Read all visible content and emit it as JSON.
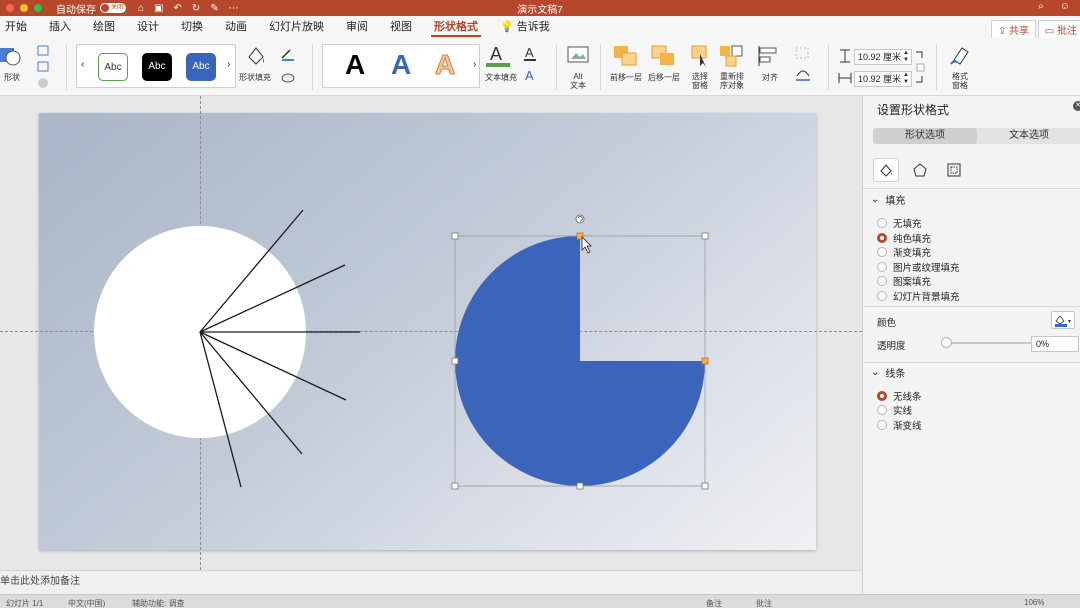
{
  "titlebar": {
    "autosave_label": "自动保存",
    "toggle_label": "关闭",
    "doc_title": "演示文稿7"
  },
  "tabs": [
    {
      "label": "开始"
    },
    {
      "label": "插入"
    },
    {
      "label": "绘图"
    },
    {
      "label": "设计"
    },
    {
      "label": "切换"
    },
    {
      "label": "动画"
    },
    {
      "label": "幻灯片放映"
    },
    {
      "label": "审阅"
    },
    {
      "label": "视图"
    },
    {
      "label": "形状格式",
      "active": true
    },
    {
      "label": "告诉我"
    }
  ],
  "header_buttons": {
    "share": "共享",
    "comment": "批注"
  },
  "ribbon": {
    "shape_label": "形状",
    "styles": [
      "Abc",
      "Abc",
      "Abc"
    ],
    "shape_fill_label": "形状填充",
    "wordart_letter": "A",
    "text_fill_label": "文本填充",
    "alt_text_label": "Alt\n文本",
    "alt_line1": "Alt",
    "alt_line2": "文本",
    "bring_forward": "前移一层",
    "send_backward": "后移一层",
    "selection_pane_1": "选择",
    "selection_pane_2": "窗格",
    "reorder_1": "重新排",
    "reorder_2": "序对象",
    "align_label": "对齐",
    "height_value": "10.92 厘米",
    "width_value": "10.92 厘米",
    "format_pane_1": "格式",
    "format_pane_2": "窗格"
  },
  "notes": {
    "placeholder": "单击此处添加备注"
  },
  "statusbar": {
    "slide_info": "幻灯片 1/1",
    "language": "中文(中国)",
    "accessibility": "辅助功能: 调查",
    "notes_btn": "备注",
    "comments_btn": "批注",
    "zoom": "106%"
  },
  "pane": {
    "title": "设置形状格式",
    "tab_shape": "形状选项",
    "tab_text": "文本选项",
    "fill_section": "填充",
    "fill_options": [
      {
        "label": "无填充",
        "selected": false
      },
      {
        "label": "纯色填充",
        "selected": true
      },
      {
        "label": "渐变填充",
        "selected": false
      },
      {
        "label": "图片或纹理填充",
        "selected": false
      },
      {
        "label": "图案填充",
        "selected": false
      },
      {
        "label": "幻灯片背景填充",
        "selected": false
      }
    ],
    "color_label": "颜色",
    "transparency_label": "透明度",
    "transparency_value": "0%",
    "line_section": "线条",
    "line_options": [
      {
        "label": "无线条",
        "selected": true
      },
      {
        "label": "实线",
        "selected": false
      },
      {
        "label": "渐变线",
        "selected": false
      }
    ]
  },
  "colors": {
    "accent": "#b7472a",
    "shape_blue": "#3b64bb",
    "fill_color_swatch": "#2f6bd0"
  }
}
